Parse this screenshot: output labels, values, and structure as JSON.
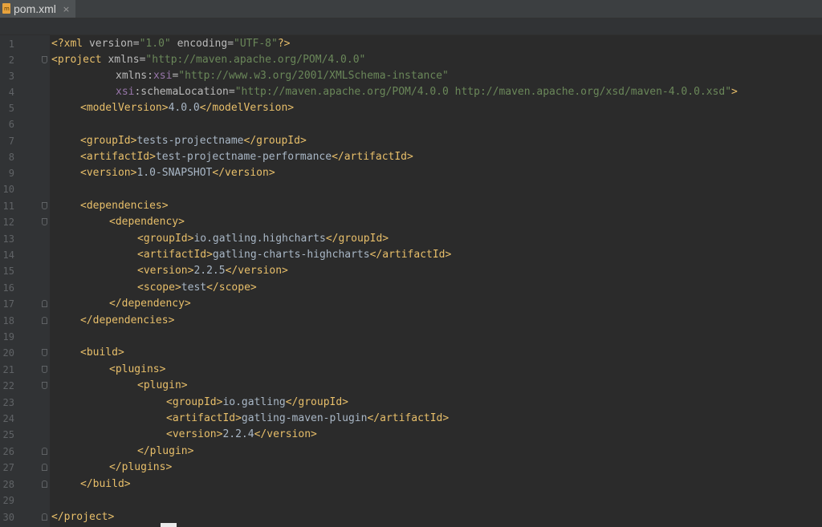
{
  "tab": {
    "label": "pom.xml",
    "close": "×",
    "icon": "maven-file-icon",
    "icon_color": "#e8a33d"
  },
  "colors": {
    "background": "#2b2b2b",
    "tag": "#e8bf6a",
    "attribute": "#bababa",
    "namespace": "#9876aa",
    "value": "#6a8759",
    "text": "#a9b7c6",
    "line_number": "#606366"
  },
  "lines": [
    {
      "n": "1"
    },
    {
      "n": "2"
    },
    {
      "n": "3"
    },
    {
      "n": "4"
    },
    {
      "n": "5"
    },
    {
      "n": "6"
    },
    {
      "n": "7"
    },
    {
      "n": "8"
    },
    {
      "n": "9"
    },
    {
      "n": "10"
    },
    {
      "n": "11"
    },
    {
      "n": "12"
    },
    {
      "n": "13"
    },
    {
      "n": "14"
    },
    {
      "n": "15"
    },
    {
      "n": "16"
    },
    {
      "n": "17"
    },
    {
      "n": "18"
    },
    {
      "n": "19"
    },
    {
      "n": "20"
    },
    {
      "n": "21"
    },
    {
      "n": "22"
    },
    {
      "n": "23"
    },
    {
      "n": "24"
    },
    {
      "n": "25"
    },
    {
      "n": "26"
    },
    {
      "n": "27"
    },
    {
      "n": "28"
    },
    {
      "n": "29"
    },
    {
      "n": "30"
    }
  ],
  "code": {
    "l1": {
      "a": "<?xml ",
      "b": "version",
      "c": "=",
      "d": "\"1.0\"",
      "e": " ",
      "f": "encoding",
      "g": "=",
      "h": "\"UTF-8\"",
      "i": "?>"
    },
    "l2": {
      "a": "<project ",
      "b": "xmlns",
      "c": "=",
      "d": "\"http://maven.apache.org/POM/4.0.0\""
    },
    "l3": {
      "a": "xmlns",
      "b": ":",
      "c": "xsi",
      "d": "=",
      "e": "\"http://www.w3.org/2001/XMLSchema-instance\""
    },
    "l4": {
      "a": "xsi",
      "b": ":schemaLocation",
      "c": "=",
      "d": "\"http://maven.apache.org/POM/4.0.0 http://maven.apache.org/xsd/maven-4.0.0.xsd\"",
      "e": ">"
    },
    "l5": {
      "a": "<modelVersion>",
      "b": "4.0.0",
      "c": "</modelVersion>"
    },
    "l7": {
      "a": "<groupId>",
      "b": "tests-projectname",
      "c": "</groupId>"
    },
    "l8": {
      "a": "<artifactId>",
      "b": "test-projectname-performance",
      "c": "</artifactId>"
    },
    "l9": {
      "a": "<version>",
      "b": "1.0-SNAPSHOT",
      "c": "</version>"
    },
    "l11": {
      "a": "<dependencies>"
    },
    "l12": {
      "a": "<dependency>"
    },
    "l13": {
      "a": "<groupId>",
      "b": "io.gatling.highcharts",
      "c": "</groupId>"
    },
    "l14": {
      "a": "<artifactId>",
      "b": "gatling-charts-highcharts",
      "c": "</artifactId>"
    },
    "l15": {
      "a": "<version>",
      "b": "2.2.5",
      "c": "</version>"
    },
    "l16": {
      "a": "<scope>",
      "b": "test",
      "c": "</scope>"
    },
    "l17": {
      "a": "</dependency>"
    },
    "l18": {
      "a": "</dependencies>"
    },
    "l20": {
      "a": "<build>"
    },
    "l21": {
      "a": "<plugins>"
    },
    "l22": {
      "a": "<plugin>"
    },
    "l23": {
      "a": "<groupId>",
      "b": "io.gatling",
      "c": "</groupId>"
    },
    "l24": {
      "a": "<artifactId>",
      "b": "gatling-maven-plugin",
      "c": "</artifactId>"
    },
    "l25": {
      "a": "<version>",
      "b": "2.2.4",
      "c": "</version>"
    },
    "l26": {
      "a": "</plugin>"
    },
    "l27": {
      "a": "</plugins>"
    },
    "l28": {
      "a": "</build>"
    },
    "l30": {
      "a": "</project>"
    }
  }
}
